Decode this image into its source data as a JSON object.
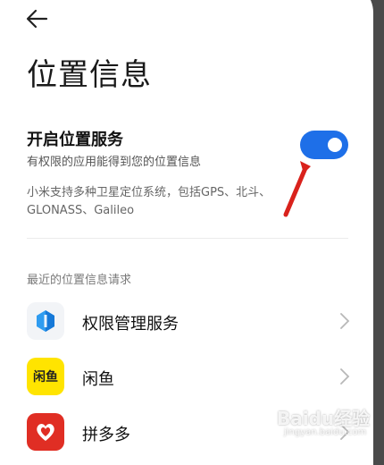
{
  "page": {
    "title": "位置信息"
  },
  "location_service": {
    "title": "开启位置服务",
    "subtitle": "有权限的应用能得到您的位置信息",
    "enabled": true,
    "accent_color": "#1e6fe8",
    "description": "小米支持多种卫星定位系统，包括GPS、北斗、GLONASS、Galileo"
  },
  "recent": {
    "section_label": "最近的位置信息请求",
    "items": [
      {
        "label": "权限管理服务",
        "icon": "permission-manager-icon"
      },
      {
        "label": "闲鱼",
        "icon": "xianyu-app-icon",
        "icon_text": "闲鱼"
      },
      {
        "label": "拼多多",
        "icon": "pinduoduo-app-icon"
      }
    ]
  },
  "annotation": {
    "arrow_color": "#d9221c"
  },
  "watermark": {
    "text": "Baidu经验",
    "sub": "jingyan.baidu.com"
  }
}
